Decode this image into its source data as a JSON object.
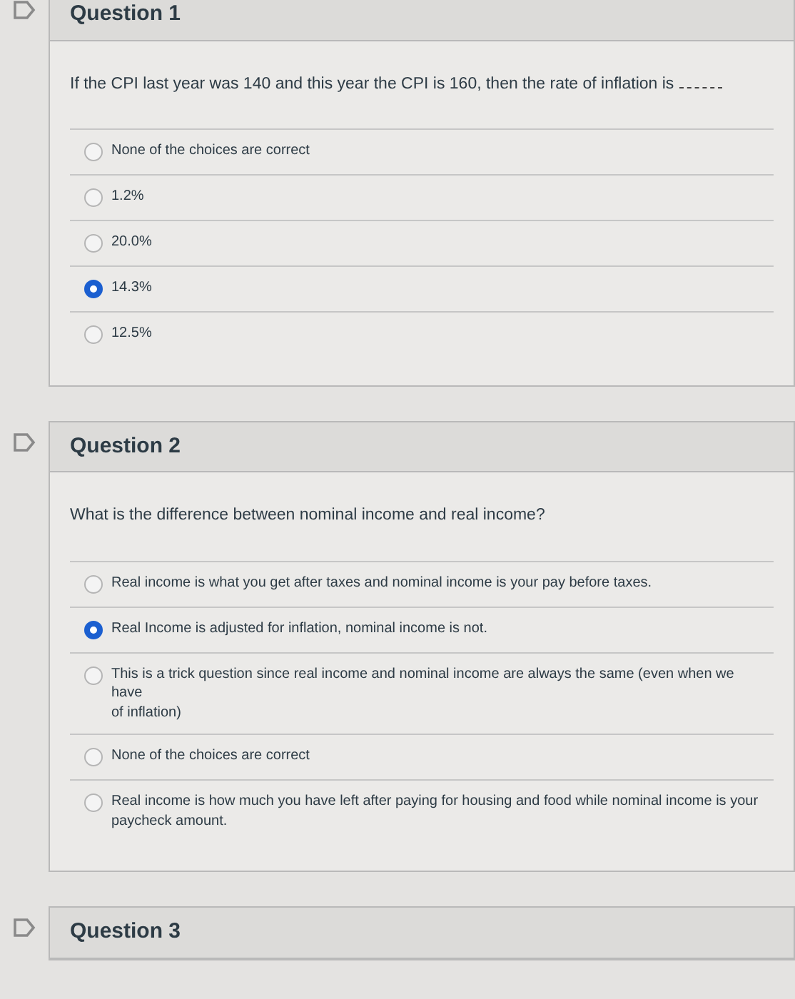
{
  "questions": [
    {
      "title": "Question 1",
      "prompt": "If the CPI last year was 140 and this year the CPI is 160, then the rate of inflation is",
      "blank": true,
      "options": [
        {
          "text": "None of the choices are correct",
          "selected": false
        },
        {
          "text": "1.2%",
          "selected": false
        },
        {
          "text": "20.0%",
          "selected": false
        },
        {
          "text": "14.3%",
          "selected": true
        },
        {
          "text": "12.5%",
          "selected": false
        }
      ]
    },
    {
      "title": "Question 2",
      "prompt": "What is the difference between nominal income and real income?",
      "blank": false,
      "options": [
        {
          "text": "Real income is what you get after taxes and nominal income is your pay before taxes.",
          "selected": false
        },
        {
          "text": "Real Income is adjusted for inflation, nominal income is not.",
          "selected": true
        },
        {
          "text": "This is a trick question since real income and nominal income are always the same (even when we have\nof inflation)",
          "selected": false
        },
        {
          "text": "None of the choices are correct",
          "selected": false
        },
        {
          "text": "Real income is how much you have left after paying for housing and food while nominal income is your\npaycheck amount.",
          "selected": false
        }
      ]
    },
    {
      "title": "Question 3"
    }
  ]
}
